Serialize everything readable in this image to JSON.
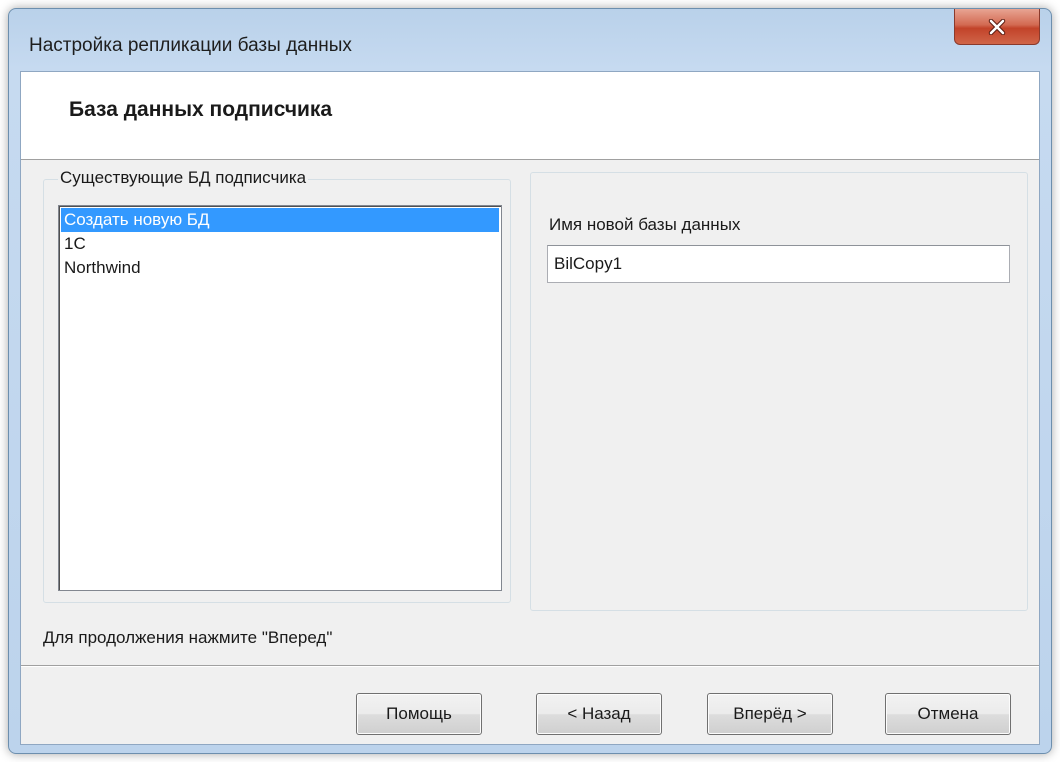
{
  "window": {
    "title": "Настройка репликации базы данных"
  },
  "header": {
    "title": "База данных подписчика"
  },
  "existing_db_group": {
    "label": "Существующие БД подписчика",
    "items": [
      {
        "label": "Создать новую БД",
        "selected": true
      },
      {
        "label": "1C",
        "selected": false
      },
      {
        "label": "Northwind",
        "selected": false
      }
    ]
  },
  "new_db": {
    "label": "Имя новой базы данных",
    "value": "BilCopy1"
  },
  "hint": "Для продолжения нажмите \"Вперед\"",
  "buttons": {
    "help": "Помощь",
    "back": "< Назад",
    "next": "Вперёд >",
    "cancel": "Отмена"
  },
  "colors": {
    "selection": "#3399ff",
    "close_button": "#c7442c"
  },
  "icons": {
    "close": "close-icon"
  }
}
